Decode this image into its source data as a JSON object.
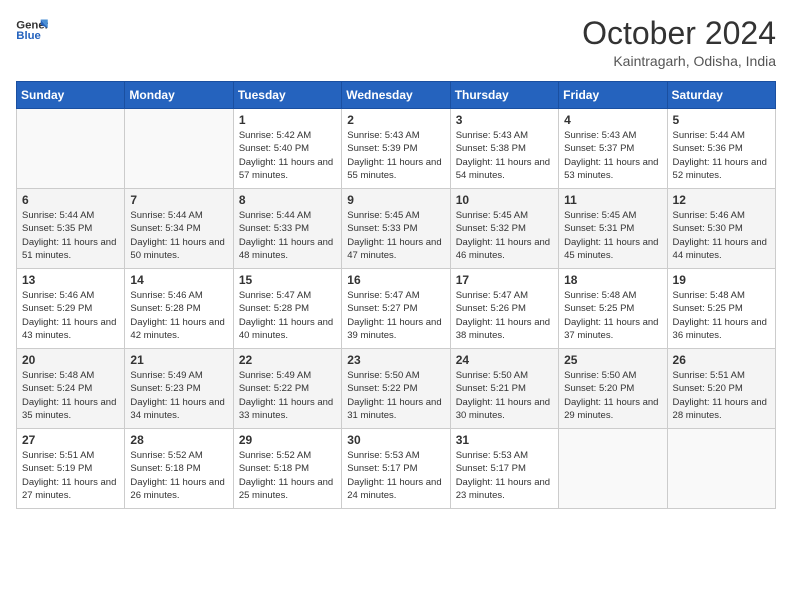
{
  "header": {
    "logo_line1": "General",
    "logo_line2": "Blue",
    "month_title": "October 2024",
    "subtitle": "Kaintragarh, Odisha, India"
  },
  "weekdays": [
    "Sunday",
    "Monday",
    "Tuesday",
    "Wednesday",
    "Thursday",
    "Friday",
    "Saturday"
  ],
  "weeks": [
    [
      null,
      null,
      {
        "day": "1",
        "sunrise": "Sunrise: 5:42 AM",
        "sunset": "Sunset: 5:40 PM",
        "daylight": "Daylight: 11 hours and 57 minutes."
      },
      {
        "day": "2",
        "sunrise": "Sunrise: 5:43 AM",
        "sunset": "Sunset: 5:39 PM",
        "daylight": "Daylight: 11 hours and 55 minutes."
      },
      {
        "day": "3",
        "sunrise": "Sunrise: 5:43 AM",
        "sunset": "Sunset: 5:38 PM",
        "daylight": "Daylight: 11 hours and 54 minutes."
      },
      {
        "day": "4",
        "sunrise": "Sunrise: 5:43 AM",
        "sunset": "Sunset: 5:37 PM",
        "daylight": "Daylight: 11 hours and 53 minutes."
      },
      {
        "day": "5",
        "sunrise": "Sunrise: 5:44 AM",
        "sunset": "Sunset: 5:36 PM",
        "daylight": "Daylight: 11 hours and 52 minutes."
      }
    ],
    [
      {
        "day": "6",
        "sunrise": "Sunrise: 5:44 AM",
        "sunset": "Sunset: 5:35 PM",
        "daylight": "Daylight: 11 hours and 51 minutes."
      },
      {
        "day": "7",
        "sunrise": "Sunrise: 5:44 AM",
        "sunset": "Sunset: 5:34 PM",
        "daylight": "Daylight: 11 hours and 50 minutes."
      },
      {
        "day": "8",
        "sunrise": "Sunrise: 5:44 AM",
        "sunset": "Sunset: 5:33 PM",
        "daylight": "Daylight: 11 hours and 48 minutes."
      },
      {
        "day": "9",
        "sunrise": "Sunrise: 5:45 AM",
        "sunset": "Sunset: 5:33 PM",
        "daylight": "Daylight: 11 hours and 47 minutes."
      },
      {
        "day": "10",
        "sunrise": "Sunrise: 5:45 AM",
        "sunset": "Sunset: 5:32 PM",
        "daylight": "Daylight: 11 hours and 46 minutes."
      },
      {
        "day": "11",
        "sunrise": "Sunrise: 5:45 AM",
        "sunset": "Sunset: 5:31 PM",
        "daylight": "Daylight: 11 hours and 45 minutes."
      },
      {
        "day": "12",
        "sunrise": "Sunrise: 5:46 AM",
        "sunset": "Sunset: 5:30 PM",
        "daylight": "Daylight: 11 hours and 44 minutes."
      }
    ],
    [
      {
        "day": "13",
        "sunrise": "Sunrise: 5:46 AM",
        "sunset": "Sunset: 5:29 PM",
        "daylight": "Daylight: 11 hours and 43 minutes."
      },
      {
        "day": "14",
        "sunrise": "Sunrise: 5:46 AM",
        "sunset": "Sunset: 5:28 PM",
        "daylight": "Daylight: 11 hours and 42 minutes."
      },
      {
        "day": "15",
        "sunrise": "Sunrise: 5:47 AM",
        "sunset": "Sunset: 5:28 PM",
        "daylight": "Daylight: 11 hours and 40 minutes."
      },
      {
        "day": "16",
        "sunrise": "Sunrise: 5:47 AM",
        "sunset": "Sunset: 5:27 PM",
        "daylight": "Daylight: 11 hours and 39 minutes."
      },
      {
        "day": "17",
        "sunrise": "Sunrise: 5:47 AM",
        "sunset": "Sunset: 5:26 PM",
        "daylight": "Daylight: 11 hours and 38 minutes."
      },
      {
        "day": "18",
        "sunrise": "Sunrise: 5:48 AM",
        "sunset": "Sunset: 5:25 PM",
        "daylight": "Daylight: 11 hours and 37 minutes."
      },
      {
        "day": "19",
        "sunrise": "Sunrise: 5:48 AM",
        "sunset": "Sunset: 5:25 PM",
        "daylight": "Daylight: 11 hours and 36 minutes."
      }
    ],
    [
      {
        "day": "20",
        "sunrise": "Sunrise: 5:48 AM",
        "sunset": "Sunset: 5:24 PM",
        "daylight": "Daylight: 11 hours and 35 minutes."
      },
      {
        "day": "21",
        "sunrise": "Sunrise: 5:49 AM",
        "sunset": "Sunset: 5:23 PM",
        "daylight": "Daylight: 11 hours and 34 minutes."
      },
      {
        "day": "22",
        "sunrise": "Sunrise: 5:49 AM",
        "sunset": "Sunset: 5:22 PM",
        "daylight": "Daylight: 11 hours and 33 minutes."
      },
      {
        "day": "23",
        "sunrise": "Sunrise: 5:50 AM",
        "sunset": "Sunset: 5:22 PM",
        "daylight": "Daylight: 11 hours and 31 minutes."
      },
      {
        "day": "24",
        "sunrise": "Sunrise: 5:50 AM",
        "sunset": "Sunset: 5:21 PM",
        "daylight": "Daylight: 11 hours and 30 minutes."
      },
      {
        "day": "25",
        "sunrise": "Sunrise: 5:50 AM",
        "sunset": "Sunset: 5:20 PM",
        "daylight": "Daylight: 11 hours and 29 minutes."
      },
      {
        "day": "26",
        "sunrise": "Sunrise: 5:51 AM",
        "sunset": "Sunset: 5:20 PM",
        "daylight": "Daylight: 11 hours and 28 minutes."
      }
    ],
    [
      {
        "day": "27",
        "sunrise": "Sunrise: 5:51 AM",
        "sunset": "Sunset: 5:19 PM",
        "daylight": "Daylight: 11 hours and 27 minutes."
      },
      {
        "day": "28",
        "sunrise": "Sunrise: 5:52 AM",
        "sunset": "Sunset: 5:18 PM",
        "daylight": "Daylight: 11 hours and 26 minutes."
      },
      {
        "day": "29",
        "sunrise": "Sunrise: 5:52 AM",
        "sunset": "Sunset: 5:18 PM",
        "daylight": "Daylight: 11 hours and 25 minutes."
      },
      {
        "day": "30",
        "sunrise": "Sunrise: 5:53 AM",
        "sunset": "Sunset: 5:17 PM",
        "daylight": "Daylight: 11 hours and 24 minutes."
      },
      {
        "day": "31",
        "sunrise": "Sunrise: 5:53 AM",
        "sunset": "Sunset: 5:17 PM",
        "daylight": "Daylight: 11 hours and 23 minutes."
      },
      null,
      null
    ]
  ]
}
